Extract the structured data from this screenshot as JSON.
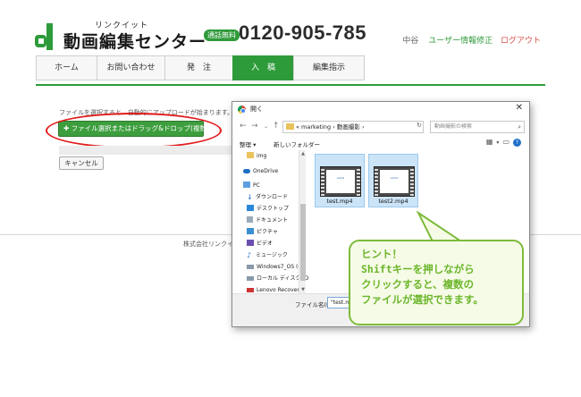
{
  "header": {
    "logo_sub": "リンクイット",
    "logo_title": "動画編集センター",
    "free_badge": "通話無料",
    "phone": "0120-905-785",
    "user_name": "中谷",
    "user_edit": "ユーザー情報修正",
    "logout": "ログアウト"
  },
  "nav": {
    "tabs": [
      "ホーム",
      "お問い合わせ",
      "発　注",
      "入　稿",
      "編集指示"
    ],
    "active_index": 3
  },
  "upload": {
    "info": "ファイルを選択すると、自動的にアップロードが始まります。",
    "button": "✚ ファイル選択またはドラッグ&ドロップ(複数可)",
    "cancel": "キャンセル"
  },
  "footer": {
    "company": "株式会社リンクイット"
  },
  "dialog": {
    "title": "開く",
    "close": "✕",
    "breadcrumb": "« marketing › 動画撮影 ›",
    "search_placeholder": "動画撮影の検索",
    "organize": "整理 ▾",
    "new_folder": "新しいフォルダー",
    "sidebar": [
      {
        "label": "img",
        "icon": "folder-icon"
      },
      {
        "label": "OneDrive",
        "icon": "cloud-icon"
      },
      {
        "label": "PC",
        "icon": "pc-icon"
      },
      {
        "label": "ダウンロード",
        "icon": "download-icon"
      },
      {
        "label": "デスクトップ",
        "icon": "desktop-icon"
      },
      {
        "label": "ドキュメント",
        "icon": "documents-icon"
      },
      {
        "label": "ピクチャ",
        "icon": "pictures-icon"
      },
      {
        "label": "ビデオ",
        "icon": "video-icon"
      },
      {
        "label": "ミュージック",
        "icon": "music-icon"
      },
      {
        "label": "Windows7_OS (C",
        "icon": "drive-icon"
      },
      {
        "label": "ローカル ディスク (D",
        "icon": "drive-icon"
      },
      {
        "label": "Lenovo Recover",
        "icon": "drive-icon"
      }
    ],
    "files": [
      {
        "name": "test.mp4",
        "thumb_text": "Linkit"
      },
      {
        "name": "test2.mp4",
        "thumb_text": "Linkit"
      }
    ],
    "filename_label": "ファイル名(N):",
    "filename_value": "\"test.mp4\" \"test2.mp4\""
  },
  "hint": {
    "lines": [
      "ヒント！",
      "Shiftキーを押しながら",
      "クリックすると、複数の",
      "ファイルが選択できます。"
    ]
  },
  "colors": {
    "brand_green": "#2e9b3a",
    "alert_red": "#e11a1a",
    "hint_green": "#6bb62a"
  }
}
